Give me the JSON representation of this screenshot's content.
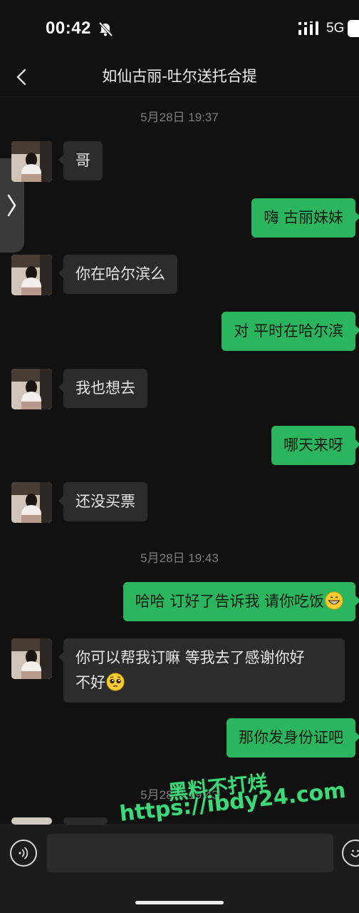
{
  "status_bar": {
    "time": "00:42",
    "network": "5G",
    "icons": [
      "bell-muted-icon",
      "signal-icon",
      "battery-icon"
    ]
  },
  "header": {
    "back_icon": "chevron-left-icon",
    "title": "如仙古丽-吐尔送托合提"
  },
  "timestamps": [
    "5月28日 19:37",
    "5月28日 19:43",
    "5月28日 19:43"
  ],
  "messages": [
    {
      "from": "contact",
      "text": "哥"
    },
    {
      "from": "me",
      "text": "嗨 古丽妹妹"
    },
    {
      "from": "contact",
      "text": "你在哈尔滨么"
    },
    {
      "from": "me",
      "text": "对 平时在哈尔滨"
    },
    {
      "from": "contact",
      "text": "我也想去"
    },
    {
      "from": "me",
      "text": "哪天来呀"
    },
    {
      "from": "contact",
      "text": "还没买票"
    },
    {
      "from": "me",
      "text": "哈哈 订好了告诉我 请你吃饭",
      "emoji": "grinning-face-icon"
    },
    {
      "from": "contact",
      "text_line1": "你可以帮我订嘛 等我去了感谢你好",
      "text_line2": "不好",
      "emoji": "pleading-face-icon"
    },
    {
      "from": "me",
      "text": "那你发身份证吧"
    }
  ],
  "watermark": {
    "line1": "黑料不打烊",
    "line2": "https://ibdy24.com"
  },
  "input_bar": {
    "voice_icon": "voice-icon",
    "emoji_icon": "emoji-icon"
  },
  "colors": {
    "background": "#111111",
    "incoming_bubble": "#2c2c2c",
    "outgoing_bubble": "#2bb55f",
    "watermark": "#3ed77a"
  }
}
